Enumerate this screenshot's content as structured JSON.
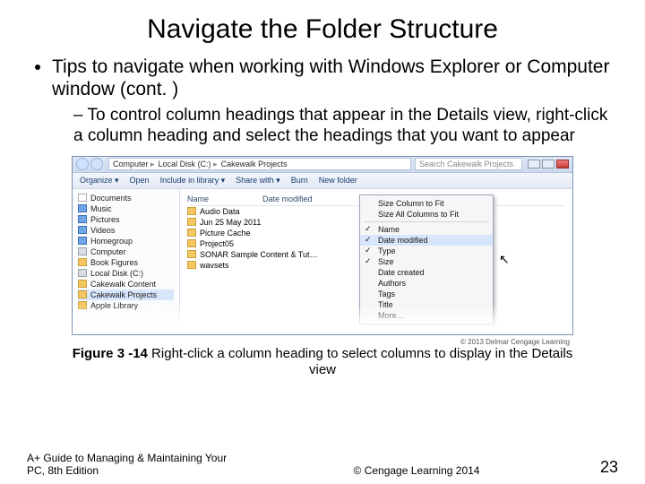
{
  "title": "Navigate the Folder Structure",
  "bullet": "Tips to navigate when working with Windows Explorer or Computer window (cont. )",
  "sub_bullet": "To control column headings that appear in the Details view, right-click a column heading and select the headings that you want to appear",
  "explorer": {
    "breadcrumbs": [
      "Computer",
      "Local Disk (C:)",
      "Cakewalk Projects"
    ],
    "search_placeholder": "Search Cakewalk Projects",
    "toolbar": [
      "Organize ▾",
      "Open",
      "Include in library ▾",
      "Share with ▾",
      "Burn",
      "New folder"
    ],
    "nav": {
      "items": [
        {
          "label": "Documents",
          "icon": "doc"
        },
        {
          "label": "Music",
          "icon": "blue"
        },
        {
          "label": "Pictures",
          "icon": "blue"
        },
        {
          "label": "Videos",
          "icon": "blue"
        },
        {
          "label": "Homegroup",
          "icon": "blue"
        },
        {
          "label": "Computer",
          "icon": "drv"
        },
        {
          "label": "Book Figures",
          "icon": "ico"
        },
        {
          "label": "Local Disk (C:)",
          "icon": "drv"
        },
        {
          "label": "Cakewalk Content",
          "icon": "ico"
        },
        {
          "label": "Cakewalk Projects",
          "icon": "ico",
          "sel": true
        },
        {
          "label": "Apple Library",
          "icon": "ico"
        }
      ]
    },
    "columns": [
      "Name",
      "Date modified"
    ],
    "files": [
      "Audio Data",
      "Jun 25 May 2011",
      "Picture Cache",
      "Project05",
      "SONAR Sample Content & Tut…",
      "wavsets"
    ],
    "context_top": [
      "Size Column to Fit",
      "Size All Columns to Fit"
    ],
    "context_items": [
      {
        "label": "Name",
        "checked": true
      },
      {
        "label": "Date modified",
        "checked": true,
        "hover": true
      },
      {
        "label": "Type",
        "checked": true
      },
      {
        "label": "Size",
        "checked": true
      },
      {
        "label": "Date created",
        "checked": false
      },
      {
        "label": "Authors",
        "checked": false
      },
      {
        "label": "Tags",
        "checked": false
      },
      {
        "label": "Title",
        "checked": false
      },
      {
        "label": "More...",
        "checked": false
      }
    ]
  },
  "figure_caption_bold": "Figure 3 -14",
  "figure_caption_rest": " Right-click a column heading to select columns to display in the Details view",
  "screenshot_credit": "© 2013 Delmar Cengage Learning",
  "footer": {
    "book": "A+ Guide to Managing & Maintaining Your PC, 8th Edition",
    "copyright": "© Cengage Learning  2014",
    "page": "23"
  }
}
